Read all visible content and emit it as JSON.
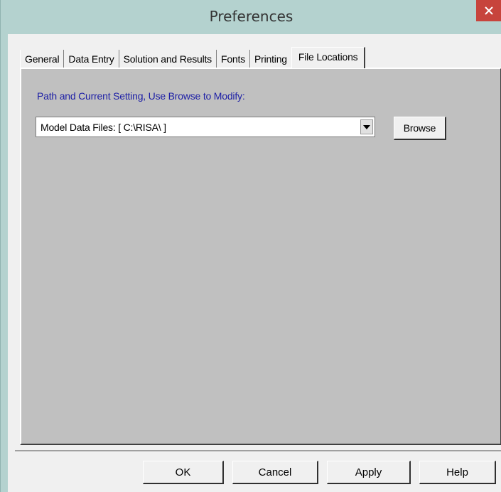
{
  "window": {
    "title": "Preferences",
    "close_glyph": "✕"
  },
  "tabs": [
    {
      "label": "General"
    },
    {
      "label": "Data Entry"
    },
    {
      "label": "Solution and Results"
    },
    {
      "label": "Fonts"
    },
    {
      "label": "Printing"
    },
    {
      "label": "File Locations",
      "active": true
    }
  ],
  "file_locations": {
    "instruction": "Path and Current Setting, Use Browse to Modify:",
    "selected_path": "Model Data Files:  [ C:\\RISA\\ ]",
    "browse_label": "Browse"
  },
  "buttons": {
    "ok": "OK",
    "cancel": "Cancel",
    "apply": "Apply",
    "help": "Help"
  },
  "colors": {
    "title_bar": "#b4d2cf",
    "close_button": "#c7443c",
    "panel_background": "#c0c0c0",
    "instruction_text": "#1e20a6"
  },
  "icons": {
    "close": "close-icon",
    "dropdown": "chevron-down-icon"
  }
}
